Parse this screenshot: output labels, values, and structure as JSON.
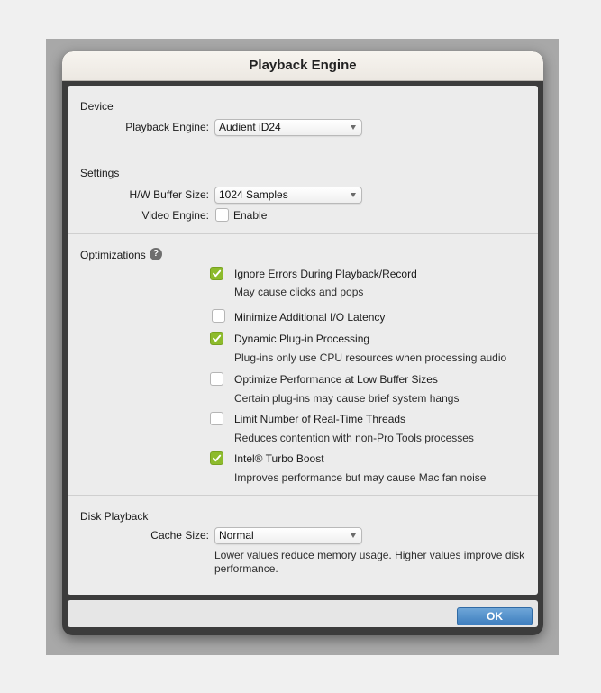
{
  "window": {
    "title": "Playback Engine"
  },
  "device": {
    "section_title": "Device",
    "playback_engine_label": "Playback Engine:",
    "playback_engine_value": "Audient iD24"
  },
  "settings": {
    "section_title": "Settings",
    "buffer_label": "H/W Buffer Size:",
    "buffer_value": "1024 Samples",
    "video_label": "Video Engine:",
    "video_option": {
      "label": "Enable",
      "checked": false
    }
  },
  "optimizations": {
    "section_title": "Optimizations",
    "help_glyph": "?",
    "options": [
      {
        "label": "Ignore Errors During Playback/Record",
        "checked": true,
        "description": "May cause clicks and pops"
      },
      {
        "label": "Minimize Additional I/O Latency",
        "checked": false
      },
      {
        "label": "Dynamic Plug-in Processing",
        "checked": true,
        "description": "Plug-ins only use CPU resources when processing audio"
      },
      {
        "label": "Optimize Performance at Low Buffer Sizes",
        "checked": false,
        "description": "Certain plug-ins may cause brief system hangs"
      },
      {
        "label": "Limit Number of Real-Time Threads",
        "checked": false,
        "description": "Reduces contention with non-Pro Tools processes"
      },
      {
        "label": "Intel® Turbo Boost",
        "checked": true,
        "description": "Improves performance but may cause Mac fan noise"
      }
    ]
  },
  "disk": {
    "section_title": "Disk Playback",
    "cache_label": "Cache Size:",
    "cache_value": "Normal",
    "note_line1": "Lower values reduce memory usage. Higher values improve disk",
    "note_line2": "performance."
  },
  "footer": {
    "ok_label": "OK"
  },
  "colors": {
    "checkbox_checked": "#8dbb2c",
    "ok_button": "#3f7fbf"
  }
}
